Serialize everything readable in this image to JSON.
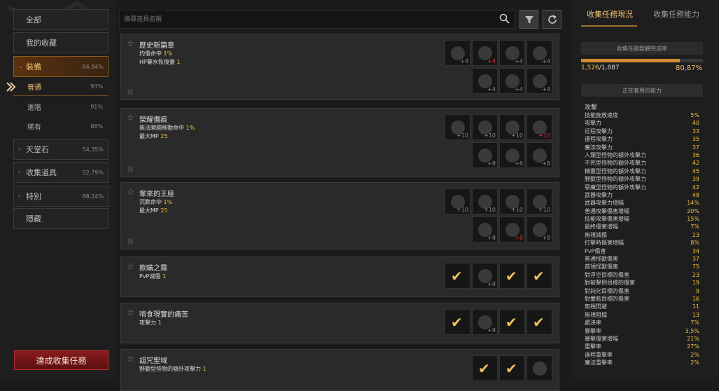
{
  "sidebar": {
    "categories": [
      {
        "label": "全部",
        "pct": ""
      },
      {
        "label": "我的收藏",
        "pct": ""
      },
      {
        "label": "裝備",
        "pct": "84,94%"
      },
      {
        "label": "天堂石",
        "pct": "54,35%"
      },
      {
        "label": "收集道具",
        "pct": "52,79%"
      },
      {
        "label": "特別",
        "pct": "88,24%"
      },
      {
        "label": "隱藏",
        "pct": ""
      }
    ],
    "subcategories": [
      {
        "label": "普通",
        "pct": "93%"
      },
      {
        "label": "進階",
        "pct": "91%"
      },
      {
        "label": "稀有",
        "pct": "68%"
      }
    ],
    "complete_button": "達成收集任務"
  },
  "search": {
    "placeholder": "搜尋道具名稱"
  },
  "cards": [
    {
      "title": "歷史新篇章",
      "effects": [
        {
          "name": "灼傷命中",
          "value": "1%"
        },
        {
          "name": "HP藥水恢復量",
          "value": "1"
        }
      ],
      "slots": [
        {
          "lv": "+4",
          "red": false,
          "done": false
        },
        {
          "lv": "+4",
          "red": true,
          "done": false
        },
        {
          "lv": "+4",
          "red": false,
          "done": false
        },
        {
          "lv": "+4",
          "red": false,
          "done": false
        },
        {
          "lv": "+4",
          "red": false,
          "done": false
        },
        {
          "lv": "+4",
          "red": false,
          "done": false
        },
        {
          "lv": "+4",
          "red": false,
          "done": false
        }
      ]
    },
    {
      "title": "榮耀傷痕",
      "effects": [
        {
          "name": "無法瞬間移動命中",
          "value": "1%"
        },
        {
          "name": "最大MP",
          "value": "25"
        }
      ],
      "slots": [
        {
          "lv": "+10",
          "red": false,
          "done": false
        },
        {
          "lv": "+10",
          "red": false,
          "done": false
        },
        {
          "lv": "+10",
          "red": false,
          "done": false
        },
        {
          "lv": "+10",
          "red": true,
          "done": false
        },
        {
          "lv": "+8",
          "red": false,
          "done": false
        },
        {
          "lv": "+8",
          "red": false,
          "done": false
        },
        {
          "lv": "+8",
          "red": false,
          "done": false
        }
      ]
    },
    {
      "title": "奪來的王座",
      "effects": [
        {
          "name": "沉默命中",
          "value": "1%"
        },
        {
          "name": "最大MP",
          "value": "25"
        }
      ],
      "slots": [
        {
          "lv": "+10",
          "red": false,
          "done": false
        },
        {
          "lv": "+10",
          "red": false,
          "done": false
        },
        {
          "lv": "+10",
          "red": false,
          "done": false
        },
        {
          "lv": "+10",
          "red": false,
          "done": false
        },
        {
          "lv": "+8",
          "red": false,
          "done": false
        },
        {
          "lv": "+8",
          "red": true,
          "done": false
        },
        {
          "lv": "+8",
          "red": false,
          "done": false
        }
      ]
    },
    {
      "title": "欺瞞之霧",
      "effects": [
        {
          "name": "PvP減傷",
          "value": "1"
        }
      ],
      "slots": [
        {
          "lv": "",
          "red": false,
          "done": true
        },
        {
          "lv": "+9",
          "red": false,
          "done": false
        },
        {
          "lv": "",
          "red": false,
          "done": true
        },
        {
          "lv": "",
          "red": false,
          "done": true
        }
      ]
    },
    {
      "title": "啃食現實的痛苦",
      "effects": [
        {
          "name": "攻擊力",
          "value": "1"
        }
      ],
      "slots": [
        {
          "lv": "",
          "red": false,
          "done": true
        },
        {
          "lv": "+9",
          "red": false,
          "done": false
        },
        {
          "lv": "",
          "red": false,
          "done": true
        },
        {
          "lv": "",
          "red": false,
          "done": true
        }
      ]
    },
    {
      "title": "詛咒聖域",
      "effects": [
        {
          "name": "野獸型怪物的額外攻擊力",
          "value": "1"
        }
      ],
      "slots": [
        {
          "lv": "",
          "red": false,
          "done": true
        },
        {
          "lv": "",
          "red": false,
          "done": true
        },
        {
          "lv": "",
          "red": false,
          "done": false
        }
      ]
    }
  ],
  "right": {
    "tabs": [
      "收集任務現況",
      "收集任務能力"
    ],
    "overall_title": "收集任務整體完成率",
    "progress_current": "1,526",
    "progress_total": "/1,887",
    "progress_pct": "80,87%",
    "progress_fraction": 0.8087,
    "active_title": "正在套用的能力",
    "section_label": "攻擊",
    "stats": [
      {
        "name": "技能施放速度",
        "value": "5%"
      },
      {
        "name": "攻擊力",
        "value": "40"
      },
      {
        "name": "近程攻擊力",
        "value": "33"
      },
      {
        "name": "遠程攻擊力",
        "value": "35"
      },
      {
        "name": "魔法攻擊力",
        "value": "37"
      },
      {
        "name": "人類型怪物的額外攻擊力",
        "value": "36"
      },
      {
        "name": "不死型怪物的額外攻擊力",
        "value": "42"
      },
      {
        "name": "精靈型怪物的額外攻擊力",
        "value": "45"
      },
      {
        "name": "野獸型怪物的額外攻擊力",
        "value": "39"
      },
      {
        "name": "惡魔型怪物的額外攻擊力",
        "value": "42"
      },
      {
        "name": "武器攻擊力",
        "value": "48"
      },
      {
        "name": "武器攻擊力增幅",
        "value": "14%"
      },
      {
        "name": "普通攻擊傷害增幅",
        "value": "20%"
      },
      {
        "name": "技能攻擊傷害增幅",
        "value": "15%"
      },
      {
        "name": "最終傷害增幅",
        "value": "7%"
      },
      {
        "name": "無視減傷",
        "value": "23"
      },
      {
        "name": "打擊時傷害增幅",
        "value": "8%"
      },
      {
        "name": "PvP傷害",
        "value": "34"
      },
      {
        "name": "普通怪獸傷害",
        "value": "37"
      },
      {
        "name": "首領怪獸傷害",
        "value": "75"
      },
      {
        "name": "對浮空目標的傷害",
        "value": "23"
      },
      {
        "name": "對被擊倒目標的傷害",
        "value": "19"
      },
      {
        "name": "對鈍化目標的傷害",
        "value": "9"
      },
      {
        "name": "對暈眩目標的傷害",
        "value": "16"
      },
      {
        "name": "無視閃避",
        "value": "11"
      },
      {
        "name": "無視阻擋",
        "value": "13"
      },
      {
        "name": "處決率",
        "value": "7%"
      },
      {
        "name": "暴擊率",
        "value": "3,5%"
      },
      {
        "name": "暴擊傷害增幅",
        "value": "21%"
      },
      {
        "name": "重擊率",
        "value": "27%"
      },
      {
        "name": "遠程重擊率",
        "value": "2%"
      },
      {
        "name": "魔法重擊率",
        "value": "2%"
      }
    ]
  }
}
